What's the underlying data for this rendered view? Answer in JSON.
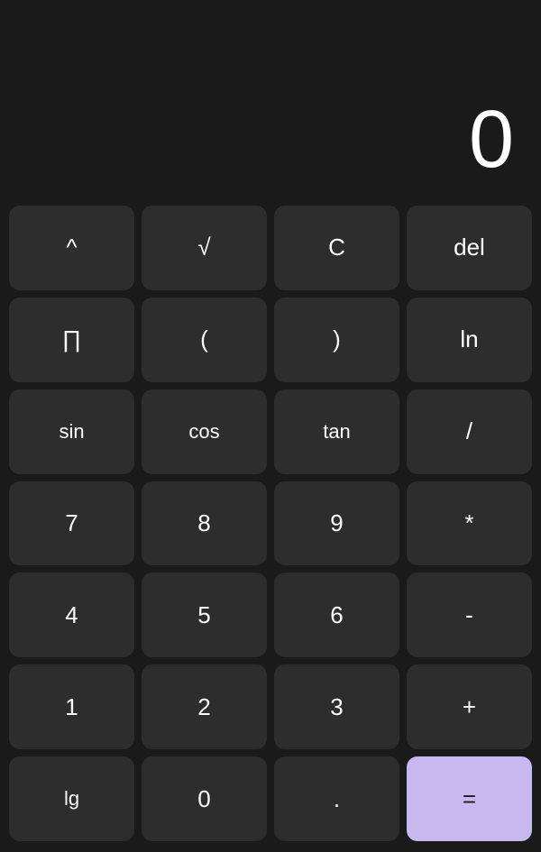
{
  "display": {
    "value": "0"
  },
  "buttons": [
    [
      {
        "label": "^",
        "id": "btn-power",
        "type": "operator"
      },
      {
        "label": "√",
        "id": "btn-sqrt",
        "type": "operator"
      },
      {
        "label": "C",
        "id": "btn-clear",
        "type": "operator"
      },
      {
        "label": "del",
        "id": "btn-del",
        "type": "operator"
      }
    ],
    [
      {
        "label": "∏",
        "id": "btn-pi",
        "type": "operator"
      },
      {
        "label": "(",
        "id": "btn-open-paren",
        "type": "operator"
      },
      {
        "label": ")",
        "id": "btn-close-paren",
        "type": "operator"
      },
      {
        "label": "ln",
        "id": "btn-ln",
        "type": "operator"
      }
    ],
    [
      {
        "label": "sin",
        "id": "btn-sin",
        "type": "trig"
      },
      {
        "label": "cos",
        "id": "btn-cos",
        "type": "trig"
      },
      {
        "label": "tan",
        "id": "btn-tan",
        "type": "trig"
      },
      {
        "label": "/",
        "id": "btn-divide",
        "type": "operator"
      }
    ],
    [
      {
        "label": "7",
        "id": "btn-7",
        "type": "number"
      },
      {
        "label": "8",
        "id": "btn-8",
        "type": "number"
      },
      {
        "label": "9",
        "id": "btn-9",
        "type": "number"
      },
      {
        "label": "*",
        "id": "btn-multiply",
        "type": "operator"
      }
    ],
    [
      {
        "label": "4",
        "id": "btn-4",
        "type": "number"
      },
      {
        "label": "5",
        "id": "btn-5",
        "type": "number"
      },
      {
        "label": "6",
        "id": "btn-6",
        "type": "number"
      },
      {
        "label": "-",
        "id": "btn-subtract",
        "type": "operator"
      }
    ],
    [
      {
        "label": "1",
        "id": "btn-1",
        "type": "number"
      },
      {
        "label": "2",
        "id": "btn-2",
        "type": "number"
      },
      {
        "label": "3",
        "id": "btn-3",
        "type": "number"
      },
      {
        "label": "+",
        "id": "btn-add",
        "type": "operator"
      }
    ],
    [
      {
        "label": "lg",
        "id": "btn-lg",
        "type": "trig"
      },
      {
        "label": "0",
        "id": "btn-0",
        "type": "number"
      },
      {
        "label": ".",
        "id": "btn-dot",
        "type": "number"
      },
      {
        "label": "=",
        "id": "btn-equals",
        "type": "equals"
      }
    ]
  ]
}
